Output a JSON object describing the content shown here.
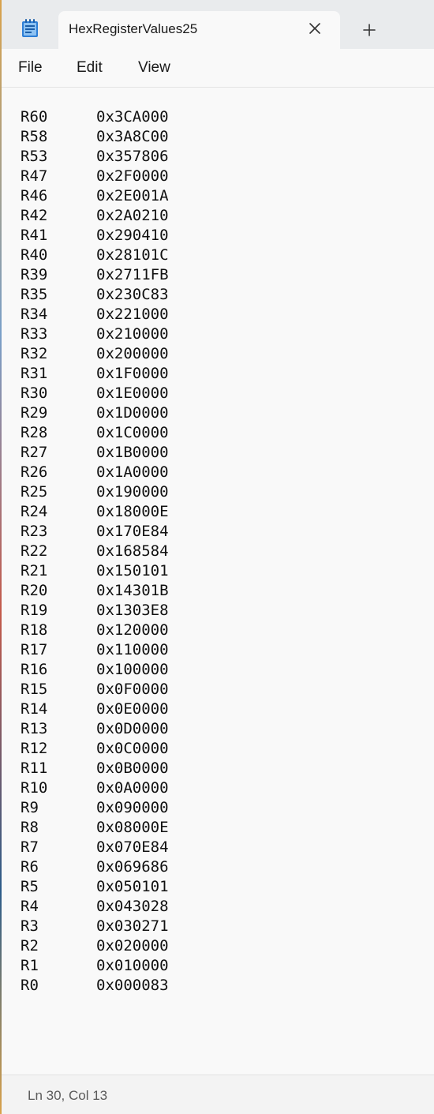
{
  "window": {
    "tab_title": "HexRegisterValues25",
    "app_icon": "notepad-icon",
    "close_icon": "close-icon",
    "new_tab_icon": "plus-icon"
  },
  "menu": {
    "file": "File",
    "edit": "Edit",
    "view": "View"
  },
  "editor": {
    "lines": [
      {
        "reg": "R60",
        "val": "0x3CA000"
      },
      {
        "reg": "R58",
        "val": "0x3A8C00"
      },
      {
        "reg": "R53",
        "val": "0x357806"
      },
      {
        "reg": "R47",
        "val": "0x2F0000"
      },
      {
        "reg": "R46",
        "val": "0x2E001A"
      },
      {
        "reg": "R42",
        "val": "0x2A0210"
      },
      {
        "reg": "R41",
        "val": "0x290410"
      },
      {
        "reg": "R40",
        "val": "0x28101C"
      },
      {
        "reg": "R39",
        "val": "0x2711FB"
      },
      {
        "reg": "R35",
        "val": "0x230C83"
      },
      {
        "reg": "R34",
        "val": "0x221000"
      },
      {
        "reg": "R33",
        "val": "0x210000"
      },
      {
        "reg": "R32",
        "val": "0x200000"
      },
      {
        "reg": "R31",
        "val": "0x1F0000"
      },
      {
        "reg": "R30",
        "val": "0x1E0000"
      },
      {
        "reg": "R29",
        "val": "0x1D0000"
      },
      {
        "reg": "R28",
        "val": "0x1C0000"
      },
      {
        "reg": "R27",
        "val": "0x1B0000"
      },
      {
        "reg": "R26",
        "val": "0x1A0000"
      },
      {
        "reg": "R25",
        "val": "0x190000"
      },
      {
        "reg": "R24",
        "val": "0x18000E"
      },
      {
        "reg": "R23",
        "val": "0x170E84"
      },
      {
        "reg": "R22",
        "val": "0x168584"
      },
      {
        "reg": "R21",
        "val": "0x150101"
      },
      {
        "reg": "R20",
        "val": "0x14301B"
      },
      {
        "reg": "R19",
        "val": "0x1303E8"
      },
      {
        "reg": "R18",
        "val": "0x120000"
      },
      {
        "reg": "R17",
        "val": "0x110000"
      },
      {
        "reg": "R16",
        "val": "0x100000"
      },
      {
        "reg": "R15",
        "val": "0x0F0000"
      },
      {
        "reg": "R14",
        "val": "0x0E0000"
      },
      {
        "reg": "R13",
        "val": "0x0D0000"
      },
      {
        "reg": "R12",
        "val": "0x0C0000"
      },
      {
        "reg": "R11",
        "val": "0x0B0000"
      },
      {
        "reg": "R10",
        "val": "0x0A0000"
      },
      {
        "reg": "R9",
        "val": "0x090000"
      },
      {
        "reg": "R8",
        "val": "0x08000E"
      },
      {
        "reg": "R7",
        "val": "0x070E84"
      },
      {
        "reg": "R6",
        "val": "0x069686"
      },
      {
        "reg": "R5",
        "val": "0x050101"
      },
      {
        "reg": "R4",
        "val": "0x043028"
      },
      {
        "reg": "R3",
        "val": "0x030271"
      },
      {
        "reg": "R2",
        "val": "0x020000"
      },
      {
        "reg": "R1",
        "val": "0x010000"
      },
      {
        "reg": "R0",
        "val": "0x000083"
      }
    ]
  },
  "status": {
    "position": "Ln 30, Col 13"
  },
  "colors": {
    "accent": "#1a73e8",
    "tabbar": "#e9ebed",
    "editor_bg": "#f9f9f9"
  }
}
